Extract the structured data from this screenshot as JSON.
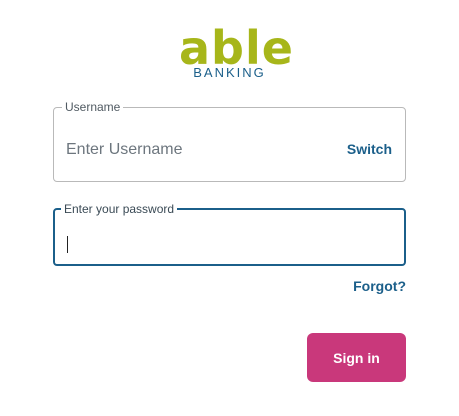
{
  "brand": {
    "logo_word": "able",
    "logo_subtitle": "BANKING",
    "logo_color": "#a7b61a",
    "subtitle_color": "#1b5f8a"
  },
  "username_field": {
    "label": "Username",
    "placeholder": "Enter Username",
    "switch_label": "Switch"
  },
  "password_field": {
    "label": "Enter your password",
    "value": "",
    "focused": true
  },
  "forgot_label": "Forgot?",
  "sign_in_button": {
    "label": "Sign in",
    "color": "#c9387b"
  },
  "accent_color": "#1b5f8a"
}
